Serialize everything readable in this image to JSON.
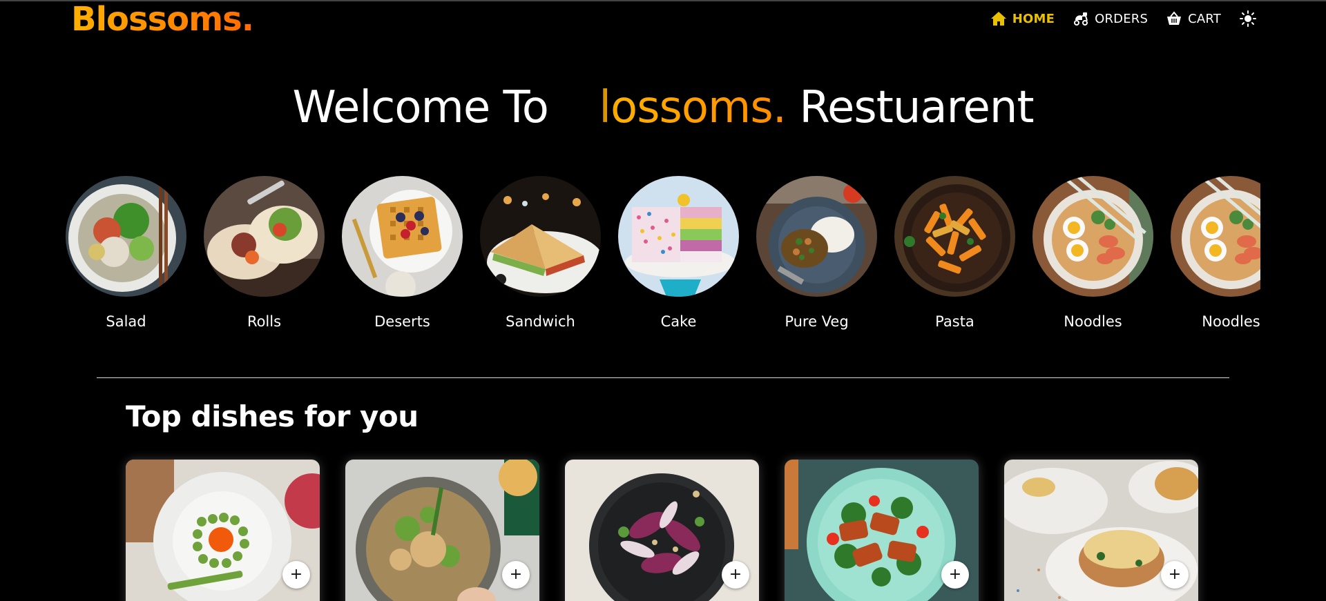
{
  "brand": {
    "logo_text": "Blossoms.",
    "accent_color": "#ff9800",
    "active_nav_color": "#e9c100"
  },
  "nav": {
    "items": [
      {
        "label": "HOME",
        "icon": "home-icon",
        "active": true
      },
      {
        "label": "ORDERS",
        "icon": "delivery-scooter-icon",
        "active": false
      },
      {
        "label": "CART",
        "icon": "basket-icon",
        "active": false
      }
    ],
    "theme_toggle_icon": "sun-icon"
  },
  "hero": {
    "prefix": "Welcome To",
    "brand_text": "lossoms.",
    "suffix": "Restuarent"
  },
  "categories": [
    {
      "label": "Salad",
      "image": "salad-bowl-image"
    },
    {
      "label": "Rolls",
      "image": "wrap-rolls-image"
    },
    {
      "label": "Deserts",
      "image": "waffle-dessert-image"
    },
    {
      "label": "Sandwich",
      "image": "sandwich-image"
    },
    {
      "label": "Cake",
      "image": "sprinkle-cake-image"
    },
    {
      "label": "Pure Veg",
      "image": "veg-curry-rice-image"
    },
    {
      "label": "Pasta",
      "image": "penne-pasta-image"
    },
    {
      "label": "Noodles",
      "image": "ramen-noodles-image"
    },
    {
      "label": "Noodles",
      "image": "ramen-noodles-image"
    }
  ],
  "top_dishes": {
    "title": "Top dishes for you",
    "add_label": "+",
    "items": [
      {
        "image": "asparagus-egg-plate-image"
      },
      {
        "image": "noodle-salad-image"
      },
      {
        "image": "radicchio-salad-image"
      },
      {
        "image": "halloumi-salad-image"
      },
      {
        "image": "cannelloni-image"
      }
    ]
  }
}
